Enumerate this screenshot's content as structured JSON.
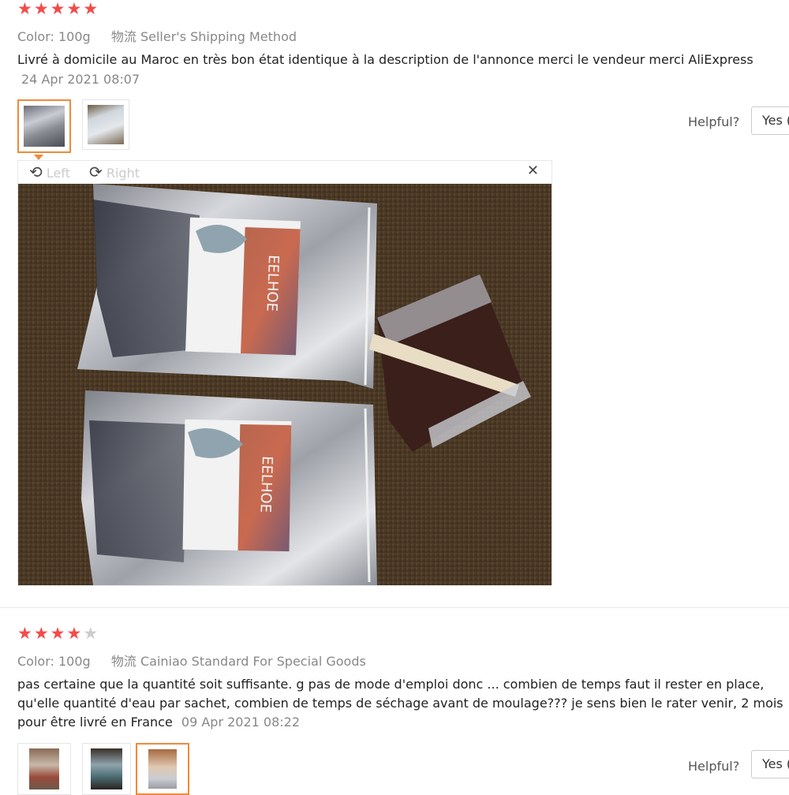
{
  "reviews": [
    {
      "stars_filled": 5,
      "stars_total": 5,
      "color_label": "Color:",
      "color_value": "100g",
      "shipping_label": "物流",
      "shipping_value": "Seller's Shipping Method",
      "text": "Livré à domicile au Maroc en très bon état identique à la description de l'annonce merci le vendeur merci AliExpress",
      "date": "24 Apr 2021 08:07",
      "helpful_label": "Helpful?",
      "yes_label": "Yes (",
      "viewer": {
        "rotate_left_label": "Left",
        "rotate_right_label": "Right",
        "close_symbol": "✕",
        "brand_text": "EELHOE"
      }
    },
    {
      "stars_filled": 4,
      "stars_total": 5,
      "color_label": "Color:",
      "color_value": "100g",
      "shipping_label": "物流",
      "shipping_value": "Cainiao Standard For Special Goods",
      "text_lines": [
        "pas certaine que la quantité soit suffisante. g pas de mode d'emploi donc ... combien de temps faut il rester en place,",
        "qu'elle quantité d'eau par sachet, combien de temps de séchage avant de moulage??? je sens bien le rater venir, 2 mois",
        "pour être livré en France"
      ],
      "date": "09 Apr 2021 08:22",
      "helpful_label": "Helpful?",
      "yes_label": "Yes ("
    }
  ],
  "colors": {
    "star_active": "#f44a4a",
    "star_inactive": "#cccccc",
    "thumb_selected": "#f08a3b"
  }
}
